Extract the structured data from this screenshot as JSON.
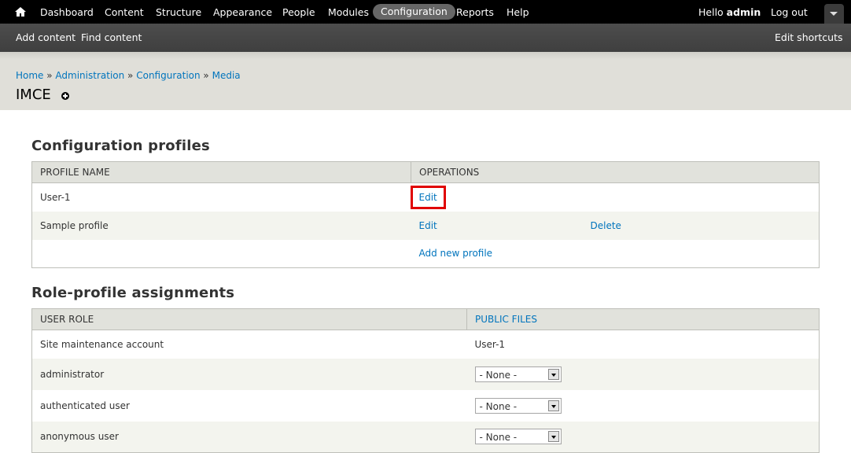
{
  "toolbar": {
    "menu": [
      "Dashboard",
      "Content",
      "Structure",
      "Appearance",
      "People",
      "Modules",
      "Configuration",
      "Reports",
      "Help"
    ],
    "active_item": "Configuration",
    "hello_prefix": "Hello ",
    "user": "admin",
    "logout": "Log out"
  },
  "shortcuts": {
    "items": [
      "Add content",
      "Find content"
    ],
    "edit": "Edit shortcuts"
  },
  "breadcrumb": {
    "items": [
      "Home",
      "Administration",
      "Configuration",
      "Media"
    ],
    "separator": " » "
  },
  "page": {
    "title": "IMCE"
  },
  "profiles": {
    "heading": "Configuration profiles",
    "columns": [
      "PROFILE NAME",
      "OPERATIONS"
    ],
    "rows": [
      {
        "name": "User-1",
        "edit": "Edit",
        "delete": ""
      },
      {
        "name": "Sample profile",
        "edit": "Edit",
        "delete": "Delete"
      }
    ],
    "add_new": "Add new profile"
  },
  "assignments": {
    "heading": "Role-profile assignments",
    "columns": [
      "USER ROLE",
      "PUBLIC FILES"
    ],
    "rows": [
      {
        "role": "Site maintenance account",
        "value": "User-1"
      },
      {
        "role": "administrator",
        "value": "- None -"
      },
      {
        "role": "authenticated user",
        "value": "- None -"
      },
      {
        "role": "anonymous user",
        "value": "- None -"
      }
    ]
  },
  "colors": {
    "link": "#0074bd",
    "highlight": "#e00000",
    "toolbar_bg": "#000000"
  }
}
